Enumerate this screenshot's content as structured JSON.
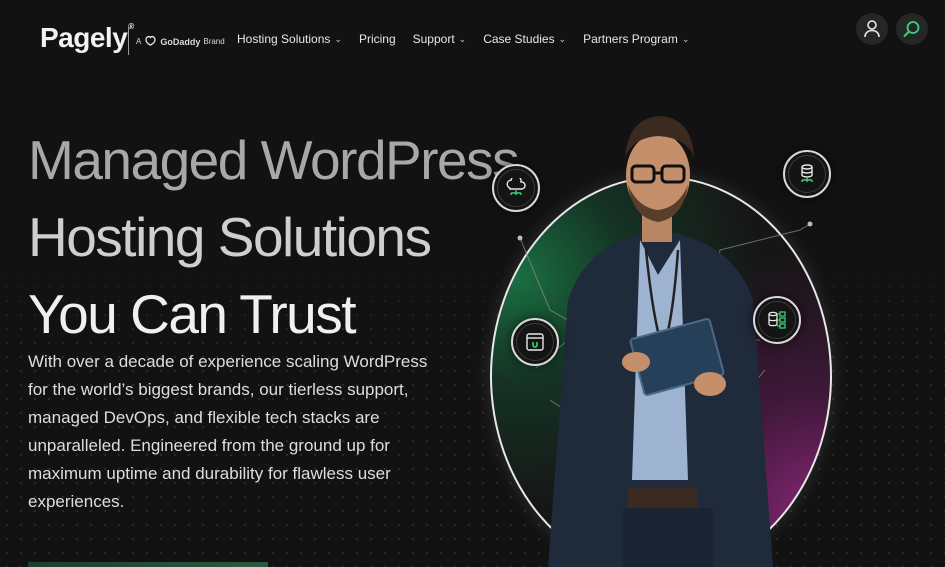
{
  "header": {
    "logo": "Pagely",
    "logo_mark": "®",
    "brand_prefix": "A",
    "brand_name": "GoDaddy",
    "brand_suffix": "Brand",
    "nav": [
      {
        "label": "Hosting Solutions",
        "has_dropdown": true
      },
      {
        "label": "Pricing",
        "has_dropdown": false
      },
      {
        "label": "Support",
        "has_dropdown": true
      },
      {
        "label": "Case Studies",
        "has_dropdown": true
      },
      {
        "label": "Partners Program",
        "has_dropdown": true
      }
    ],
    "icons": {
      "account": "user-icon",
      "search": "search-icon"
    }
  },
  "hero": {
    "title_lines": [
      "Managed WordPress",
      "Hosting Solutions",
      "You Can Trust"
    ],
    "lede": "With over a decade of experience scaling WordPress for the world’s biggest brands, our tierless support, managed DevOps, and flexible tech stacks are unparalleled. Engineered from the ground up for maximum uptime and durability for flawless user experiences.",
    "feature_icons": [
      "cloud-network-icon",
      "database-network-icon",
      "app-window-icon",
      "server-stack-icon"
    ]
  },
  "colors": {
    "background": "#121212",
    "accent_green": "#3ad07a",
    "accent_magenta": "#96288a",
    "ring": "#e8e8e8"
  }
}
